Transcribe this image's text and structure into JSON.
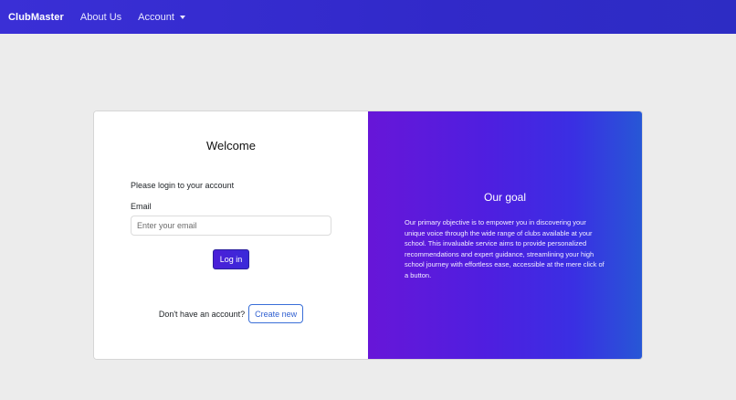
{
  "navbar": {
    "brand": "ClubMaster",
    "about_label": "About Us",
    "account_label": "Account",
    "account_icon": "caret-down-icon"
  },
  "login": {
    "welcome": "Welcome",
    "prompt": "Please login to your account",
    "email_label": "Email",
    "email_placeholder": "Enter your email",
    "email_value": "",
    "login_button": "Log in",
    "no_account_text": "Don't have an account?",
    "create_button": "Create new"
  },
  "goal": {
    "title": "Our goal",
    "description": "Our primary objective is to empower you in discovering your unique voice through the wide range of clubs available at your school. This invaluable service aims to provide personalized recommendations and expert guidance, streamlining your high school journey with effortless ease, accessible at the mere click of a button."
  },
  "colors": {
    "navbar": "#3129c9",
    "accent": "#4b1fd8",
    "gradient_start": "#6716d8",
    "gradient_end": "#2757d6",
    "background": "#ececec"
  }
}
